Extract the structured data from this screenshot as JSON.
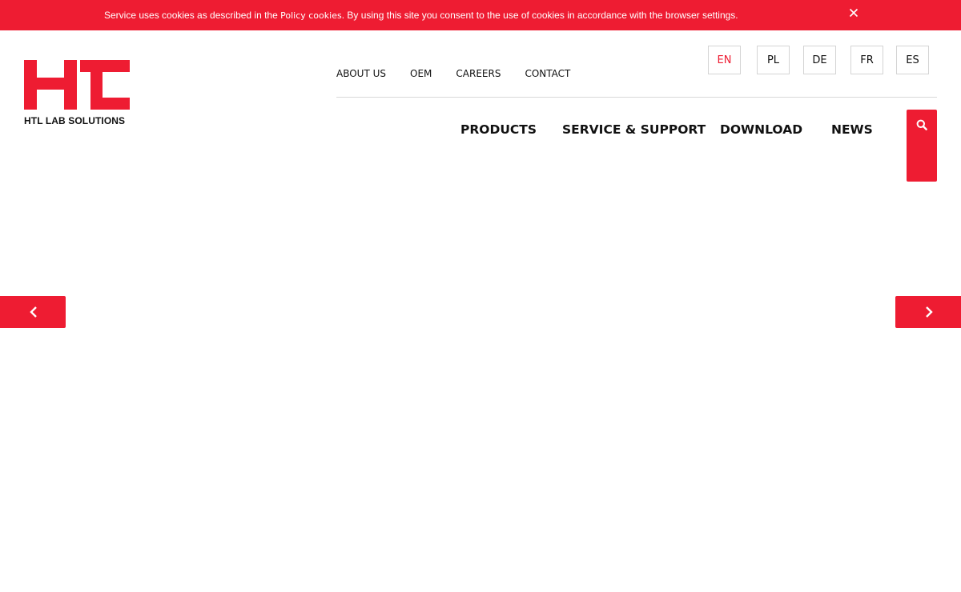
{
  "cookie_bar": {
    "text_before": "Service uses cookies as described in the ",
    "link_text": "Policy cookies",
    "text_after": ". By using this site you consent to the use of cookies in accordance with the browser settings.",
    "close_icon": "close-icon"
  },
  "logo": {
    "caption": "HTL LAB SOLUTIONS",
    "color": "#ee1c32"
  },
  "top_nav": {
    "items": [
      "ABOUT US",
      "OEM",
      "CAREERS",
      "CONTACT"
    ]
  },
  "languages": {
    "items": [
      "EN",
      "PL",
      "DE",
      "FR",
      "ES"
    ],
    "active": "EN"
  },
  "main_nav": {
    "items": [
      "PRODUCTS",
      "SERVICE & SUPPORT",
      "DOWNLOAD",
      "NEWS"
    ]
  },
  "search": {
    "icon": "search-icon"
  },
  "slider": {
    "prev_icon": "chevron-left-icon",
    "next_icon": "chevron-right-icon"
  },
  "colors": {
    "accent": "#ee1c32",
    "text": "#111111",
    "border": "#d4d4d4",
    "background": "#ffffff"
  }
}
